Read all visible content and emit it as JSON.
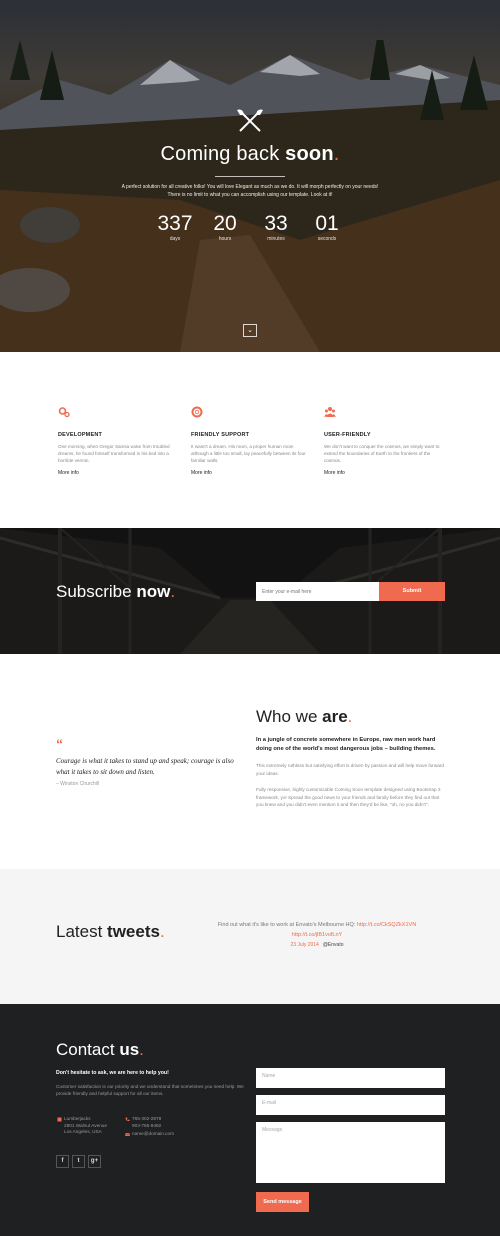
{
  "hero": {
    "title_light": "Coming back ",
    "title_bold": "soon",
    "title_dot": ".",
    "text": "A perfect solution for all creative folks! You will love Elegant as much as we do. It will morph perfectly on your needs! There is no limit to what you can accomplish using our template. Look at it!",
    "countdown": [
      {
        "value": "337",
        "label": "days"
      },
      {
        "value": "20",
        "label": "hours"
      },
      {
        "value": "33",
        "label": "minutes"
      },
      {
        "value": "01",
        "label": "seconds"
      }
    ],
    "scroll_icon": "chevron-down-icon"
  },
  "features": [
    {
      "icon": "gears-icon",
      "title": "DEVELOPMENT",
      "text": "One morning, when Gregor Samsa woke from troubled dreams, he found himself transformed in his bed into a horrible vermin.",
      "more": "More info"
    },
    {
      "icon": "lifebuoy-icon",
      "title": "FRIENDLY SUPPORT",
      "text": "It wasn't a dream. His room, a proper human room although a little too small, lay peacefully between its four familiar walls.",
      "more": "More info"
    },
    {
      "icon": "users-icon",
      "title": "USER-FRIENDLY",
      "text": "We don't want to conquer the cosmos, we simply want to extend the boundaries of Earth to the frontiers of the cosmos.",
      "more": "More info"
    }
  ],
  "subscribe": {
    "title_light": "Subscribe ",
    "title_bold": "now",
    "title_dot": ".",
    "placeholder": "Enter your e-mail here",
    "button": "Submit"
  },
  "quote": {
    "mark": "“",
    "text": "Courage is what it takes to stand up and speak; courage is also what it takes to sit down and listen.",
    "author": "– Winston Churchill"
  },
  "about": {
    "title_light": "Who we ",
    "title_bold": "are",
    "title_dot": ".",
    "lead": "In a jungle of concrete somewhere in Europe, raw men work hard doing one of the world's most dangerous jobs – building themes.",
    "p1": "This extremely ruthless but satisfying effort is driven by passion and will help move forward your ideas.",
    "p2": "Fully responsive, highly customizable Coming Soon template designed using Bootstrap 3 framework, yo! Spread the good news to your friends and family before they find out that you knew and you didn't even mention it and then they'd be like, \"oh, no you didn't\"."
  },
  "tweets": {
    "title_light": "Latest ",
    "title_bold": "tweets",
    "title_dot": ".",
    "text": "Find out what it's like to work at Envato's Melbourne HQ: ",
    "link1": "http://t.co/CkSQZkX1VN",
    "link2": "http://t.co/jlB1vofLnY",
    "date": "23 July 2014",
    "user": "@Envato"
  },
  "contact": {
    "title_light": "Contact ",
    "title_bold": "us",
    "title_dot": ".",
    "lead": "Don't hesitate to ask, we are here to help you!",
    "text": "Customer satisfaction is our priority and we understand that sometimes you need help. We provide friendly and helpful support for all our items.",
    "address": [
      "Lumberjacks",
      "2801 Walnut Avenue",
      "Los Angeles, USA"
    ],
    "phones": [
      "765-302-2878",
      "903-765-9492"
    ],
    "email": "name@domain.com",
    "social": [
      "f",
      "t",
      "g+"
    ],
    "name_placeholder": "Name",
    "email_placeholder": "E-mail",
    "message_placeholder": "Message",
    "send": "Send message"
  },
  "colors": {
    "accent": "#f06a4f",
    "dark": "#1f2022",
    "light": "#f5f5f5"
  }
}
